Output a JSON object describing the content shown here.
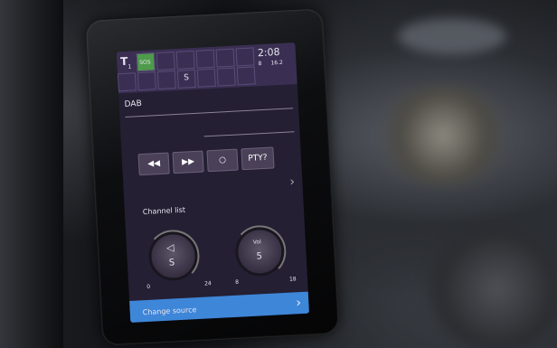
{
  "screen": {
    "clock": "2:08",
    "status_small": "8",
    "status_right": "16.2",
    "tuner_label": "T",
    "tuner_sub": "1",
    "active_badge": "SOS",
    "source_name": "DAB",
    "buttons": {
      "rewind": "◀◀",
      "forward": "▶▶",
      "scan": "○",
      "pty": "PTY?"
    },
    "channel_list": "Channel list",
    "volume_knob": {
      "value": "S",
      "scale_min": "0",
      "scale_max": "24"
    },
    "tone_knob": {
      "value": "5",
      "scale_min": "8",
      "scale_max": "18",
      "label": "Vol"
    },
    "change_source": "Change source",
    "confirm": "✓"
  },
  "colors": {
    "screen_bg": "#241f33",
    "topbar": "#3a2f52",
    "accent_green": "#4e9b4b",
    "source_blue": "#3e86d8"
  }
}
